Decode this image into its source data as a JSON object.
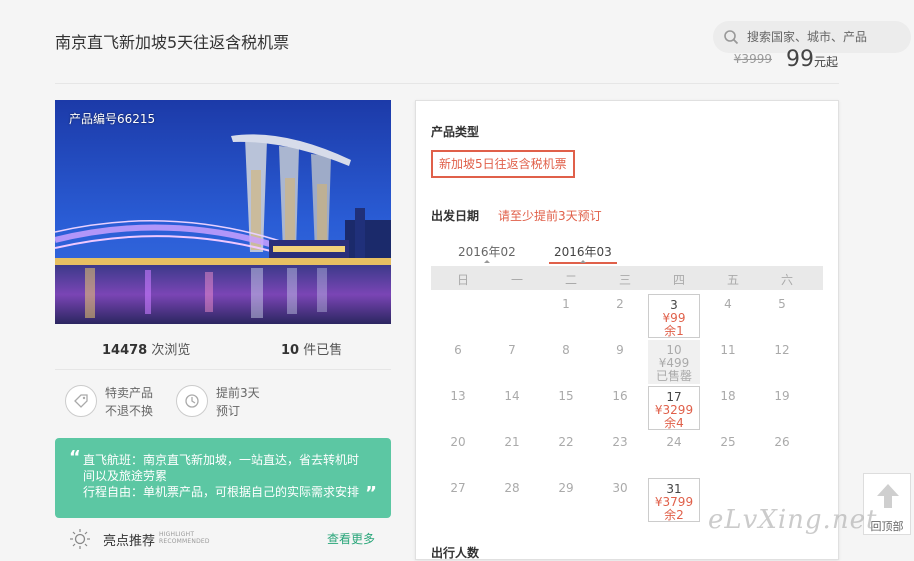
{
  "header": {
    "title": "南京直飞新加坡5天往返含税机票",
    "search_placeholder": "搜索国家、城市、产品",
    "old_price": "¥3999",
    "price": "99",
    "price_unit": "元起"
  },
  "product": {
    "number_label": "产品编号66215",
    "views_count": "14478",
    "views_label": "次浏览",
    "sold_count": "10",
    "sold_label": "件已售"
  },
  "badges": [
    {
      "icon": "tag-icon",
      "line1": "特卖产品",
      "line2": "不退不换"
    },
    {
      "icon": "clock-icon",
      "line1": "提前3天",
      "line2": "预订"
    }
  ],
  "quote": {
    "open": "“",
    "close": "”",
    "line1": "直飞航班：南京直飞新加坡，一站直达，省去转机时",
    "line2": "间以及旅途劳累",
    "line3": "行程自由：单机票产品，可根据自己的实际需求安排"
  },
  "highlights": {
    "label": "亮点推荐",
    "eng_line1": "HIGHLIGHT",
    "eng_line2": "RECOMMENDED",
    "more": "查看更多"
  },
  "booking": {
    "type_label": "产品类型",
    "type_option": "新加坡5日往返含税机票",
    "date_label": "出发日期",
    "date_note": "请至少提前3天预订",
    "months": [
      "2016年02",
      "2016年03"
    ],
    "weekdays": [
      "日",
      "一",
      "二",
      "三",
      "四",
      "五",
      "六"
    ],
    "days": [
      {
        "d": "1",
        "col": 2,
        "row": 0
      },
      {
        "d": "2",
        "col": 3,
        "row": 0
      },
      {
        "d": "3",
        "col": 4,
        "row": 0,
        "price": "¥99",
        "stock": "余1",
        "state": "avail"
      },
      {
        "d": "4",
        "col": 5,
        "row": 0
      },
      {
        "d": "5",
        "col": 6,
        "row": 0
      },
      {
        "d": "6",
        "col": 0,
        "row": 1
      },
      {
        "d": "7",
        "col": 1,
        "row": 1
      },
      {
        "d": "8",
        "col": 2,
        "row": 1
      },
      {
        "d": "9",
        "col": 3,
        "row": 1
      },
      {
        "d": "10",
        "col": 4,
        "row": 1,
        "price": "¥499",
        "stock": "已售罄",
        "state": "soldout"
      },
      {
        "d": "11",
        "col": 5,
        "row": 1
      },
      {
        "d": "12",
        "col": 6,
        "row": 1
      },
      {
        "d": "13",
        "col": 0,
        "row": 2
      },
      {
        "d": "14",
        "col": 1,
        "row": 2
      },
      {
        "d": "15",
        "col": 2,
        "row": 2
      },
      {
        "d": "16",
        "col": 3,
        "row": 2
      },
      {
        "d": "17",
        "col": 4,
        "row": 2,
        "price": "¥3299",
        "stock": "余4",
        "state": "avail"
      },
      {
        "d": "18",
        "col": 5,
        "row": 2
      },
      {
        "d": "19",
        "col": 6,
        "row": 2
      },
      {
        "d": "20",
        "col": 0,
        "row": 3
      },
      {
        "d": "21",
        "col": 1,
        "row": 3
      },
      {
        "d": "22",
        "col": 2,
        "row": 3
      },
      {
        "d": "23",
        "col": 3,
        "row": 3
      },
      {
        "d": "24",
        "col": 4,
        "row": 3
      },
      {
        "d": "25",
        "col": 5,
        "row": 3
      },
      {
        "d": "26",
        "col": 6,
        "row": 3
      },
      {
        "d": "27",
        "col": 0,
        "row": 4
      },
      {
        "d": "28",
        "col": 1,
        "row": 4
      },
      {
        "d": "29",
        "col": 2,
        "row": 4
      },
      {
        "d": "30",
        "col": 3,
        "row": 4
      },
      {
        "d": "31",
        "col": 4,
        "row": 4,
        "price": "¥3799",
        "stock": "余2",
        "state": "avail"
      }
    ],
    "people_label": "出行人数"
  },
  "back_to_top": "回顶部",
  "watermark": "eLvXing.net",
  "colors": {
    "accent": "#e0604a",
    "green": "#5cc7a3",
    "link_green": "#2aa67a"
  }
}
